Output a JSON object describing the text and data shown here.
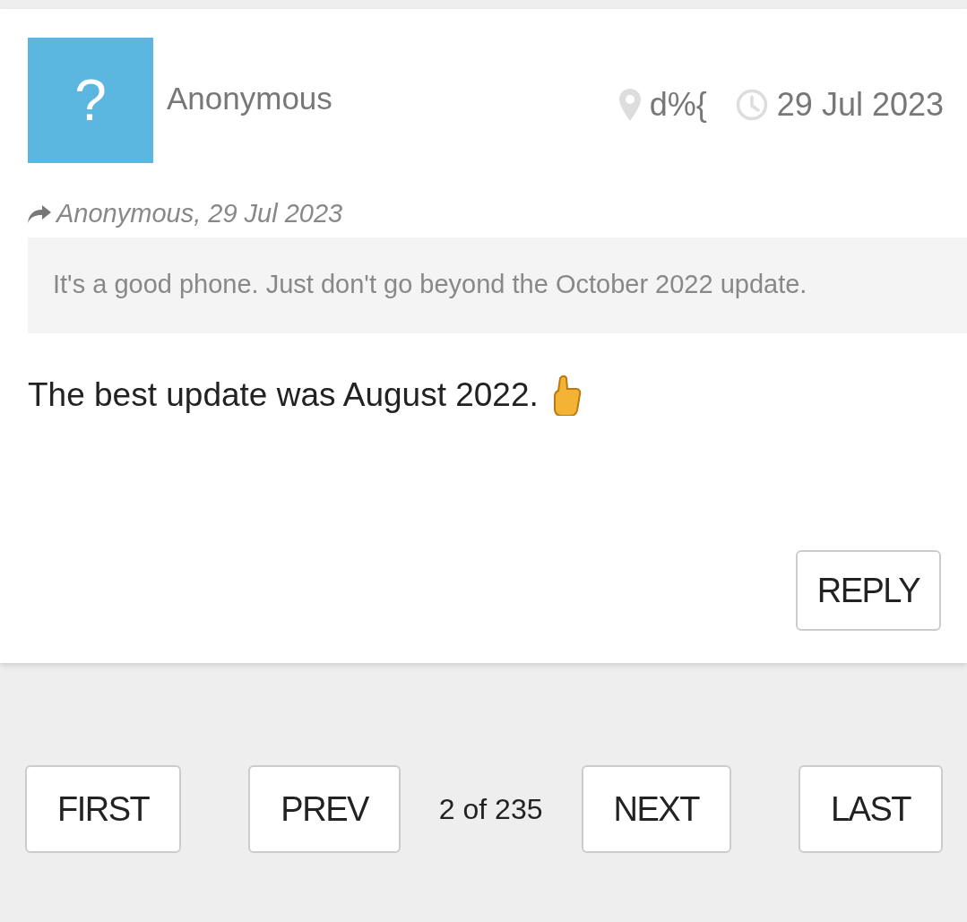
{
  "post": {
    "author": "Anonymous",
    "avatar": "?",
    "location": "d%{",
    "date": "29 Jul 2023",
    "quote": {
      "attribution": "Anonymous, 29 Jul 2023",
      "text": "It's a good phone. Just don't go beyond the October 2022 update."
    },
    "body": "The best update was August 2022.",
    "reply_button": "REPLY"
  },
  "pagination": {
    "first": "FIRST",
    "prev": "PREV",
    "page_info": "2 of 235",
    "next": "NEXT",
    "last": "LAST"
  }
}
